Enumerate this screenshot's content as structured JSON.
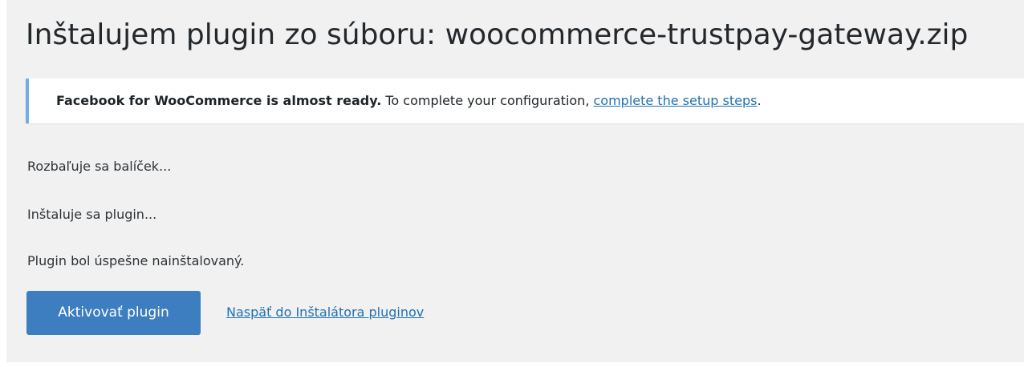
{
  "page": {
    "title": "Inštalujem plugin zo súboru: woocommerce-trustpay-gateway.zip"
  },
  "notice": {
    "bold_text": "Facebook for WooCommerce is almost ready.",
    "text": " To complete your configuration, ",
    "link_text": "complete the setup steps",
    "suffix": "."
  },
  "steps": [
    "Rozbaľuje sa balíček...",
    "Inštaluje sa plugin...",
    "Plugin bol úspešne nainštalovaný."
  ],
  "actions": {
    "activate_label": "Aktivovať plugin",
    "back_link": "Naspäť do Inštalátora pluginov"
  },
  "colors": {
    "primary": "#3d7ec0",
    "link": "#2271b1",
    "notice_border": "#72aee6",
    "background": "#f1f1f1"
  }
}
